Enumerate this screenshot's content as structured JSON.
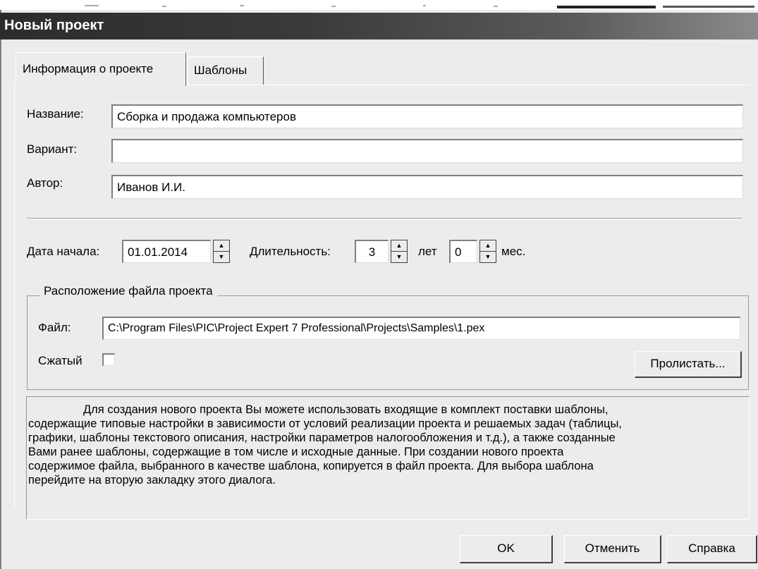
{
  "window": {
    "title": "Новый проект"
  },
  "tabs": [
    {
      "label": "Информация о проекте",
      "active": true
    },
    {
      "label": "Шаблоны",
      "active": false
    }
  ],
  "fields": {
    "name": {
      "label": "Название:",
      "value": "Сборка и продажа компьютеров"
    },
    "variant": {
      "label": "Вариант:",
      "value": ""
    },
    "author": {
      "label": "Автор:",
      "value": "Иванов И.И."
    }
  },
  "start_date": {
    "label": "Дата начала:",
    "value": "01.01.2014"
  },
  "duration": {
    "label": "Длительность:",
    "years": "3",
    "years_unit": "лет",
    "months": "0",
    "months_unit": "мес."
  },
  "file_location": {
    "group_title": "Расположение файла проекта",
    "file_label": "Файл:",
    "file_value": "C:\\Program Files\\PIC\\Project Expert 7 Professional\\Projects\\Samples\\1.pex",
    "compressed_label": "Сжатый",
    "compressed_checked": false,
    "browse_label": "Пролистать..."
  },
  "info_text": {
    "line1": "Для создания нового проекта Вы можете использовать входящие в комплект поставки шаблоны,",
    "line2": "содержащие типовые настройки в зависимости от условий реализации проекта и решаемых задач (таблицы,",
    "line3": "графики, шаблоны текстового описания, настройки параметров налогообложения и т.д.), а также созданные",
    "line4": "Вами ранее шаблоны, содержащие в том числе и исходные данные. При создании нового проекта",
    "line5": "содержимое файла, выбранного в качестве шаблона, копируется в файл проекта. Для выбора шаблона",
    "line6": "перейдите на вторую закладку этого диалога."
  },
  "buttons": {
    "ok": "OK",
    "cancel": "Отменить",
    "help": "Справка"
  }
}
